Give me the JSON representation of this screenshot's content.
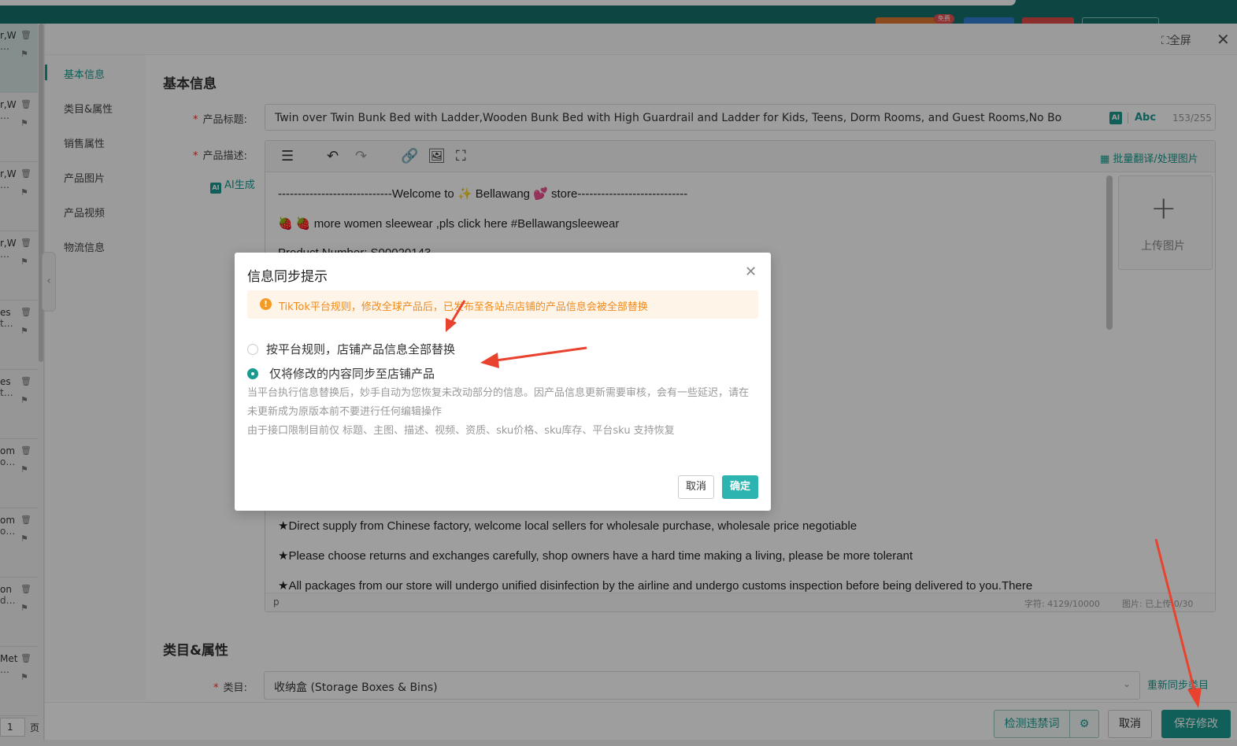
{
  "topbar": {
    "badge": "免费"
  },
  "leftlist": {
    "items": [
      {
        "title": "r,W",
        "dots": "…"
      },
      {
        "title": "r,W",
        "dots": "…"
      },
      {
        "title": "r,W",
        "dots": "…"
      },
      {
        "title": "r,W",
        "dots": "…"
      },
      {
        "title": "es",
        "dots": "t…"
      },
      {
        "title": "es",
        "dots": "t…"
      },
      {
        "title": "om",
        "dots": "o…"
      },
      {
        "title": "om",
        "dots": "o…"
      },
      {
        "title": "on",
        "dots": "d…"
      },
      {
        "title": "Met",
        "dots": "…"
      }
    ],
    "page_value": "1",
    "page_label": "页"
  },
  "drawer": {
    "fullscreen": "全屏",
    "nav": [
      "基本信息",
      "类目&属性",
      "销售属性",
      "产品图片",
      "产品视频",
      "物流信息"
    ],
    "basic_title": "基本信息",
    "title_label": "产品标题:",
    "title_value": "Twin over Twin Bunk Bed with Ladder,Wooden Bunk Bed with High Guardrail and Ladder for Kids, Teens, Dorm Rooms, and Guest Rooms,No Box Spring Ne",
    "title_ai": "AI",
    "title_abc": "Abc",
    "title_count": "153/255",
    "desc_label": "产品描述:",
    "ai_gen": "AI生成",
    "batch_translate": "批量翻译/处理图片",
    "upload_label": "上传图片",
    "editor_lines": [
      "-----------------------------Welcome to ✨ Bellawang 💕 store----------------------------",
      "🍓 🍓  more women sleewear ,pls click here #Bellawangsleewear",
      "Product Number: S00020143",
      "★Direct supply from Chinese factory, welcome local sellers for wholesale purchase, wholesale price negotiable",
      "★Please choose returns and exchanges carefully, shop owners have a hard time making a living, please be more tolerant",
      "★All packages from our store will undergo unified disinfection by the airline and undergo customs inspection before being delivered to you.There"
    ],
    "editor_path": "p",
    "char_count": "字符: 4129/10000",
    "img_count": "图片: 已上传 0/30",
    "category_title": "类目&属性",
    "category_label": "类目:",
    "category_value": "收纳盒 (Storage Boxes & Bins)",
    "resync": "重新同步类目",
    "btn_detect": "检测违禁词",
    "btn_cancel": "取消",
    "btn_save": "保存修改"
  },
  "dialog": {
    "title": "信息同步提示",
    "alert": "TikTok平台规则，修改全球产品后，已发布至各站点店铺的产品信息会被全部替换",
    "option1": "按平台规则，店铺产品信息全部替换",
    "option2": "仅将修改的内容同步至店铺产品",
    "selected_option": "option2",
    "desc1": "当平台执行信息替换后，妙手自动为您恢复未改动部分的信息。因产品信息更新需要审核，会有一些延迟，请在未更新成为原版本前不要进行任何编辑操作",
    "desc2": "由于接口限制目前仅 标题、主图、描述、视频、资质、sku价格、sku库存、平台sku 支持恢复",
    "cancel": "取消",
    "confirm": "确定"
  },
  "colors": {
    "accent": "#1a9a8f",
    "warning": "#f08a1c",
    "annotation": "#e8432f"
  }
}
